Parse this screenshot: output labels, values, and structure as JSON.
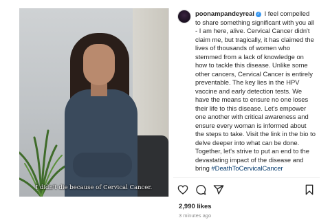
{
  "post": {
    "username": "poonampandeyreal",
    "caption_body": "I feel compelled to share something significant with you all - I am here, alive. Cervical Cancer didn't claim me, but tragically, it has claimed the lives of thousands of women who stemmed from a lack of knowledge on how to tackle this disease. Unlike some other cancers, Cervical Cancer is entirely preventable. The key lies in the HPV vaccine and early detection tests. We have the means to ensure no one loses their life to this disease. Let's empower one another with critical awareness and ensure every woman is informed about the steps to take. Visit the link in the bio to delve deeper into what can be done. Together, let's strive to put an end to the devastating impact of the disease and bring",
    "hashtag": "#DeathToCervicalCancer",
    "likes": "2,990 likes",
    "time": "3 minutes ago"
  },
  "video": {
    "subtitle": "I didn't die because of Cervical Cancer."
  },
  "icons": {
    "verified": "verified-badge",
    "like": "heart-icon",
    "comment": "comment-icon",
    "share": "send-icon",
    "save": "bookmark-icon"
  },
  "colors": {
    "verified": "#3897f0",
    "hashtag": "#00376b",
    "text": "#262626",
    "muted": "#8e8e8e"
  }
}
